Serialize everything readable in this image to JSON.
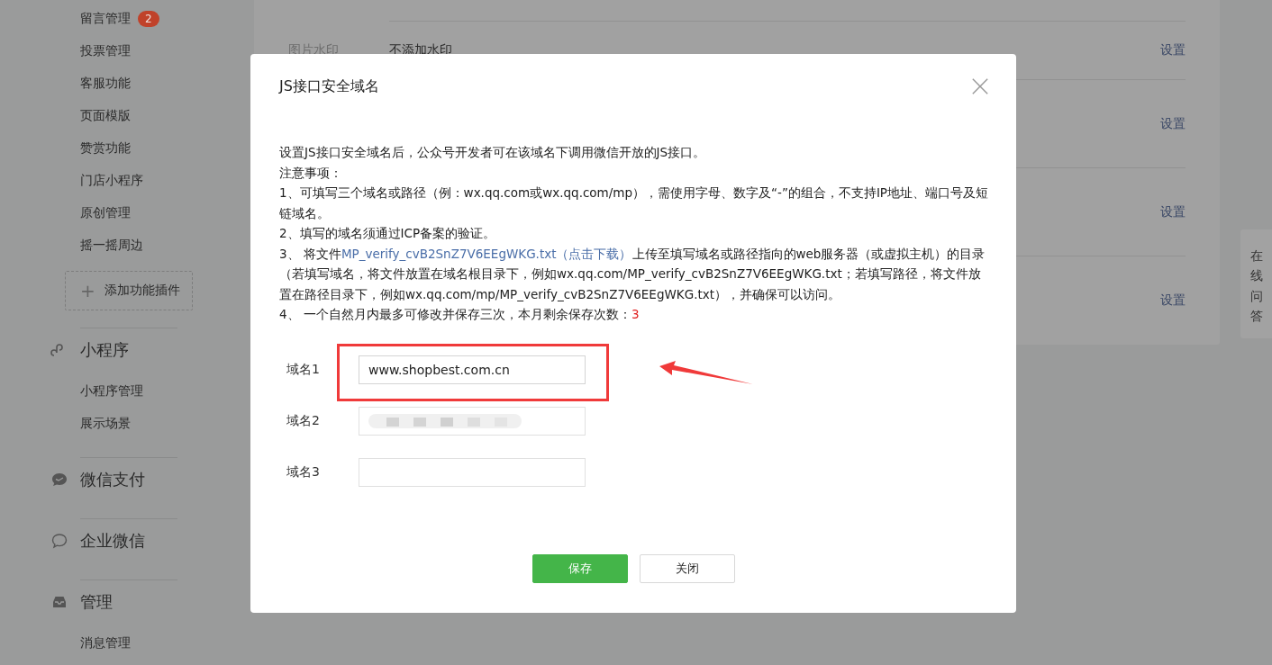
{
  "sidebar": {
    "items": [
      {
        "label": "留言管理",
        "badge": "2"
      },
      {
        "label": "投票管理"
      },
      {
        "label": "客服功能"
      },
      {
        "label": "页面模版"
      },
      {
        "label": "赞赏功能"
      },
      {
        "label": "门店小程序"
      },
      {
        "label": "原创管理"
      },
      {
        "label": "摇一摇周边"
      }
    ],
    "add_plugin": {
      "icon": "+",
      "label": "添加功能插件"
    },
    "sections": [
      {
        "title": "小程序",
        "items": [
          "小程序管理",
          "展示场景"
        ]
      },
      {
        "title": "微信支付"
      },
      {
        "title": "企业微信"
      },
      {
        "title": "管理",
        "items": [
          "消息管理"
        ]
      }
    ]
  },
  "main_panel": {
    "rows": [
      {
        "label": "图片水印",
        "value": "不添加水印",
        "action": "设置"
      },
      {
        "action": "设置"
      },
      {
        "action": "设置"
      },
      {
        "action": "设置"
      }
    ]
  },
  "help_tab": {
    "label": "在线问答"
  },
  "dialog": {
    "title": "JS接口安全域名",
    "intro": "设置JS接口安全域名后，公众号开发者可在该域名下调用微信开放的JS接口。",
    "notes_title": "注意事项：",
    "notes": [
      {
        "kind": "text",
        "text": "1、可填写三个域名或路径（例：wx.qq.com或wx.qq.com/mp），需使用字母、数字及“-”的组合，不支持IP地址、端口号及短链域名。"
      },
      {
        "kind": "text",
        "text": "2、填写的域名须通过ICP备案的验证。"
      },
      {
        "kind": "link",
        "before": "3、 将文件",
        "link": "MP_verify_cvB2SnZ7V6EEgWKG.txt（点击下载）",
        "after": "上传至填写域名或路径指向的web服务器（或虚拟主机）的目录（若填写域名，将文件放置在域名根目录下，例如wx.qq.com/MP_verify_cvB2SnZ7V6EEgWKG.txt；若填写路径，将文件放置在路径目录下，例如wx.qq.com/mp/MP_verify_cvB2SnZ7V6EEgWKG.txt），并确保可以访问。"
      },
      {
        "kind": "count",
        "text": "4、 一个自然月内最多可修改并保存三次，本月剩余保存次数：",
        "count": "3"
      }
    ],
    "fields": [
      {
        "label": "域名1",
        "value": "www.shopbest.com.cn",
        "highlighted": true,
        "redacted": false
      },
      {
        "label": "域名2",
        "highlighted": false,
        "redacted": true
      },
      {
        "label": "域名3",
        "highlighted": false,
        "redacted": false
      }
    ],
    "buttons": [
      {
        "label": "保存",
        "kind": "primary"
      },
      {
        "label": "关闭",
        "kind": "default"
      }
    ]
  }
}
